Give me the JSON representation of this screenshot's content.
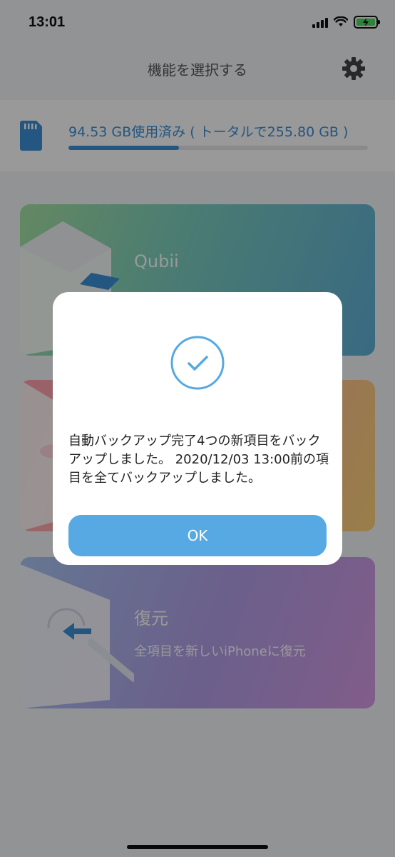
{
  "status_bar": {
    "time": "13:01"
  },
  "header": {
    "title": "機能を選択する",
    "settings_icon": "gear-icon"
  },
  "storage": {
    "text": "94.53 GB使用済み ( トータルで255.80 GB )",
    "used_fraction": 0.37
  },
  "cards": [
    {
      "title": "Qubii",
      "subtitle": ""
    },
    {
      "title": "",
      "subtitle": ""
    },
    {
      "title": "復元",
      "subtitle": "全項目を新しいiPhoneに復元"
    }
  ],
  "dialog": {
    "icon": "check-circle-icon",
    "message": "自動バックアップ完了4つの新項目をバックアップしました。 2020/12/03 13:00前の項目を全てバックアップしました。",
    "ok_label": "OK"
  },
  "colors": {
    "accent": "#56a9e2",
    "storage_text": "#3b8fd6"
  }
}
